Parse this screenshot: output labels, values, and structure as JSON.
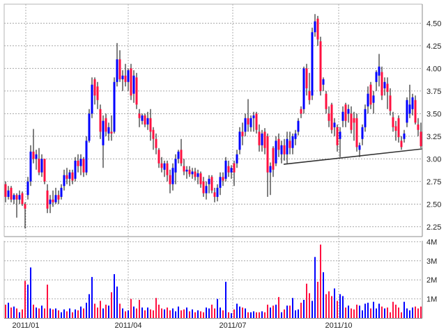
{
  "chart_data": {
    "type": "candlestick",
    "title": "",
    "colors": {
      "up": "#0000ff",
      "down": "#ff1040",
      "flat": "#000000",
      "wick": "#000000",
      "grid": "#999999",
      "trendline": "#333333"
    },
    "price_axis": {
      "ylim": [
        2.15,
        4.72
      ],
      "ticks": [
        "2.25",
        "2.50",
        "2.75",
        "3.00",
        "3.25",
        "3.50",
        "3.75",
        "4.00",
        "4.25",
        "4.50"
      ],
      "position": "right"
    },
    "volume_axis": {
      "ylim": [
        0,
        4.0
      ],
      "unit": "M",
      "ticks": [
        {
          "value": 1,
          "label": "1M"
        },
        {
          "value": 2,
          "label": "2M"
        },
        {
          "value": 3,
          "label": "3M"
        },
        {
          "value": 4,
          "label": "4M"
        }
      ],
      "position": "right"
    },
    "x_ticks": [
      {
        "label": "2011/01",
        "index": 7.25
      },
      {
        "label": "2011/04",
        "index": 44
      },
      {
        "label": "2011/07",
        "index": 81.5
      },
      {
        "label": "2011/10",
        "index": 119.5
      }
    ],
    "trendline": {
      "from": {
        "index": 99.75,
        "price": 2.94
      },
      "to": {
        "index": 149.5,
        "price": 3.11
      }
    },
    "ohlc": [
      [
        2.72,
        2.75,
        2.52,
        2.58
      ],
      [
        2.58,
        2.7,
        2.55,
        2.65
      ],
      [
        2.68,
        2.7,
        2.52,
        2.55
      ],
      [
        2.55,
        2.62,
        2.5,
        2.6
      ],
      [
        2.6,
        2.62,
        2.35,
        2.55
      ],
      [
        2.55,
        2.65,
        2.5,
        2.6
      ],
      [
        2.62,
        2.64,
        2.48,
        2.5
      ],
      [
        2.5,
        2.52,
        2.23,
        2.45
      ],
      [
        2.6,
        2.8,
        2.55,
        2.75
      ],
      [
        2.75,
        3.15,
        2.7,
        3.08
      ],
      [
        3.08,
        3.33,
        2.95,
        3.0
      ],
      [
        3.0,
        3.1,
        2.88,
        3.05
      ],
      [
        3.0,
        3.12,
        2.82,
        2.85
      ],
      [
        2.85,
        3.05,
        2.8,
        3.0
      ],
      [
        3.0,
        3.0,
        2.72,
        2.75
      ],
      [
        2.65,
        2.72,
        2.4,
        2.45
      ],
      [
        2.5,
        2.6,
        2.4,
        2.55
      ],
      [
        2.55,
        2.65,
        2.47,
        2.52
      ],
      [
        2.52,
        2.68,
        2.5,
        2.6
      ],
      [
        2.6,
        2.65,
        2.5,
        2.55
      ],
      [
        2.58,
        2.72,
        2.55,
        2.68
      ],
      [
        2.7,
        2.88,
        2.65,
        2.82
      ],
      [
        2.82,
        2.9,
        2.72,
        2.78
      ],
      [
        2.78,
        2.88,
        2.7,
        2.85
      ],
      [
        2.85,
        2.88,
        2.72,
        2.76
      ],
      [
        2.78,
        3.02,
        2.75,
        2.98
      ],
      [
        2.98,
        3.05,
        2.85,
        2.92
      ],
      [
        2.92,
        3.05,
        2.82,
        3.0
      ],
      [
        3.0,
        3.02,
        2.8,
        2.85
      ],
      [
        2.85,
        3.25,
        2.82,
        3.2
      ],
      [
        3.2,
        3.55,
        3.18,
        3.5
      ],
      [
        3.5,
        3.9,
        3.45,
        3.82
      ],
      [
        3.88,
        3.9,
        3.6,
        3.7
      ],
      [
        3.8,
        3.85,
        3.55,
        3.65
      ],
      [
        3.55,
        3.6,
        3.22,
        3.3
      ],
      [
        3.15,
        3.48,
        2.9,
        3.42
      ],
      [
        3.45,
        3.5,
        3.25,
        3.3
      ],
      [
        3.28,
        3.4,
        3.2,
        3.35
      ],
      [
        3.3,
        3.48,
        3.2,
        3.28
      ],
      [
        3.3,
        3.9,
        3.28,
        3.85
      ],
      [
        3.85,
        4.28,
        3.8,
        4.1
      ],
      [
        4.1,
        4.2,
        3.85,
        3.88
      ],
      [
        3.88,
        3.98,
        3.75,
        3.92
      ],
      [
        3.92,
        4.05,
        3.8,
        3.85
      ],
      [
        3.85,
        4.0,
        3.75,
        3.98
      ],
      [
        4.0,
        4.05,
        3.65,
        3.7
      ],
      [
        3.72,
        3.98,
        3.62,
        3.92
      ],
      [
        3.9,
        3.95,
        3.55,
        3.6
      ],
      [
        3.5,
        3.55,
        3.35,
        3.45
      ],
      [
        3.42,
        3.5,
        3.38,
        3.48
      ],
      [
        3.48,
        3.5,
        3.35,
        3.38
      ],
      [
        3.38,
        3.52,
        3.32,
        3.45
      ],
      [
        3.45,
        3.55,
        3.2,
        3.3
      ],
      [
        3.32,
        3.35,
        3.1,
        3.22
      ],
      [
        3.22,
        3.28,
        3.05,
        3.12
      ],
      [
        3.1,
        3.12,
        2.9,
        2.95
      ],
      [
        2.95,
        3.02,
        2.85,
        2.9
      ],
      [
        2.88,
        2.98,
        2.8,
        2.95
      ],
      [
        2.95,
        2.98,
        2.75,
        2.82
      ],
      [
        2.82,
        2.88,
        2.62,
        2.72
      ],
      [
        2.72,
        2.95,
        2.65,
        2.9
      ],
      [
        2.85,
        3.05,
        2.72,
        3.0
      ],
      [
        3.0,
        3.1,
        2.95,
        3.08
      ],
      [
        3.1,
        3.22,
        2.92,
        2.95
      ],
      [
        2.92,
        3.0,
        2.82,
        2.86
      ],
      [
        2.86,
        2.92,
        2.78,
        2.88
      ],
      [
        2.88,
        2.92,
        2.8,
        2.83
      ],
      [
        2.83,
        2.9,
        2.78,
        2.86
      ],
      [
        2.86,
        2.9,
        2.76,
        2.8
      ],
      [
        2.8,
        2.88,
        2.72,
        2.84
      ],
      [
        2.84,
        2.86,
        2.68,
        2.72
      ],
      [
        2.75,
        2.8,
        2.58,
        2.62
      ],
      [
        2.62,
        2.75,
        2.55,
        2.7
      ],
      [
        2.72,
        2.82,
        2.62,
        2.78
      ],
      [
        2.8,
        2.82,
        2.62,
        2.65
      ],
      [
        2.63,
        2.68,
        2.52,
        2.58
      ],
      [
        2.58,
        2.72,
        2.53,
        2.68
      ],
      [
        2.68,
        2.85,
        2.6,
        2.8
      ],
      [
        2.8,
        2.85,
        2.7,
        2.76
      ],
      [
        2.78,
        3.02,
        2.75,
        2.98
      ],
      [
        2.92,
        2.98,
        2.8,
        2.85
      ],
      [
        2.85,
        2.93,
        2.78,
        2.9
      ],
      [
        2.95,
        2.98,
        2.7,
        2.85
      ],
      [
        2.95,
        3.1,
        2.9,
        3.05
      ],
      [
        3.1,
        3.35,
        3.05,
        3.3
      ],
      [
        3.3,
        3.4,
        3.15,
        3.25
      ],
      [
        3.3,
        3.5,
        3.25,
        3.45
      ],
      [
        3.45,
        3.66,
        3.3,
        3.38
      ],
      [
        3.35,
        3.48,
        3.3,
        3.45
      ],
      [
        3.45,
        3.52,
        3.3,
        3.48
      ],
      [
        3.5,
        3.52,
        3.28,
        3.32
      ],
      [
        3.3,
        3.38,
        3.08,
        3.15
      ],
      [
        3.15,
        3.32,
        3.08,
        3.28
      ],
      [
        3.3,
        3.34,
        3.05,
        3.12
      ],
      [
        3.25,
        3.28,
        2.58,
        2.85
      ],
      [
        2.85,
        2.96,
        2.6,
        2.92
      ],
      [
        3.12,
        3.14,
        2.8,
        2.88
      ],
      [
        2.95,
        3.25,
        2.92,
        3.2
      ],
      [
        3.22,
        3.28,
        3.02,
        3.1
      ],
      [
        3.05,
        3.2,
        2.95,
        3.15
      ],
      [
        3.15,
        3.22,
        2.98,
        3.05
      ],
      [
        3.05,
        3.3,
        2.95,
        3.22
      ],
      [
        3.2,
        3.3,
        3.05,
        3.12
      ],
      [
        3.12,
        3.28,
        3.05,
        3.25
      ],
      [
        3.22,
        3.32,
        3.15,
        3.28
      ],
      [
        3.3,
        3.45,
        3.26,
        3.42
      ],
      [
        3.55,
        3.58,
        3.45,
        3.5
      ],
      [
        3.55,
        4.02,
        3.5,
        4.0
      ],
      [
        4.0,
        4.05,
        3.7,
        3.78
      ],
      [
        3.75,
        3.95,
        3.6,
        3.65
      ],
      [
        3.7,
        4.45,
        3.65,
        4.4
      ],
      [
        4.4,
        4.6,
        4.35,
        4.52
      ],
      [
        4.55,
        4.58,
        4.25,
        4.32
      ],
      [
        4.3,
        4.35,
        3.7,
        3.75
      ],
      [
        3.82,
        3.9,
        3.75,
        3.88
      ],
      [
        3.72,
        3.75,
        3.5,
        3.55
      ],
      [
        3.5,
        3.58,
        3.35,
        3.42
      ],
      [
        3.6,
        3.62,
        3.28,
        3.32
      ],
      [
        3.35,
        3.45,
        3.25,
        3.4
      ],
      [
        3.35,
        3.38,
        3.08,
        3.15
      ],
      [
        3.22,
        3.35,
        3.02,
        3.3
      ],
      [
        3.42,
        3.58,
        3.35,
        3.52
      ],
      [
        3.6,
        3.62,
        3.35,
        3.42
      ],
      [
        3.5,
        3.6,
        3.4,
        3.55
      ],
      [
        3.5,
        3.58,
        3.28,
        3.32
      ],
      [
        3.45,
        3.52,
        3.2,
        3.4
      ],
      [
        3.45,
        3.5,
        3.08,
        3.13
      ],
      [
        3.1,
        3.18,
        3.02,
        3.15
      ],
      [
        3.22,
        3.38,
        3.15,
        3.35
      ],
      [
        3.35,
        3.6,
        3.3,
        3.55
      ],
      [
        3.58,
        3.8,
        3.5,
        3.72
      ],
      [
        3.82,
        3.85,
        3.55,
        3.6
      ],
      [
        3.62,
        3.75,
        3.5,
        3.7
      ],
      [
        3.85,
        3.98,
        3.75,
        3.96
      ],
      [
        3.92,
        4.16,
        3.8,
        4.02
      ],
      [
        3.96,
        4.02,
        3.65,
        3.7
      ],
      [
        3.78,
        3.9,
        3.7,
        3.85
      ],
      [
        3.83,
        3.9,
        3.55,
        3.74
      ],
      [
        3.7,
        3.78,
        3.48,
        3.53
      ],
      [
        3.46,
        3.52,
        3.3,
        3.35
      ],
      [
        3.36,
        3.42,
        3.2,
        3.31
      ],
      [
        3.45,
        3.48,
        3.18,
        3.24
      ],
      [
        3.2,
        3.25,
        3.1,
        3.13
      ],
      [
        3.22,
        3.32,
        3.18,
        3.28
      ],
      [
        3.4,
        3.68,
        3.35,
        3.65
      ],
      [
        3.5,
        3.82,
        3.45,
        3.6
      ],
      [
        3.55,
        3.72,
        3.48,
        3.68
      ],
      [
        3.65,
        3.7,
        3.38,
        3.4
      ],
      [
        3.38,
        3.45,
        3.25,
        3.32
      ],
      [
        3.3,
        3.4,
        3.12,
        3.14
      ]
    ],
    "volume_millions": [
      0.7,
      0.8,
      0.55,
      0.6,
      0.5,
      0.3,
      0.45,
      1.95,
      1.75,
      2.65,
      0.7,
      0.55,
      0.5,
      0.65,
      0.5,
      1.75,
      0.5,
      0.45,
      0.5,
      0.4,
      0.3,
      0.45,
      0.35,
      0.5,
      0.3,
      0.45,
      0.4,
      0.6,
      0.5,
      0.8,
      1.25,
      2.15,
      0.75,
      0.55,
      0.9,
      0.5,
      0.7,
      0.65,
      1.35,
      2.3,
      1.65,
      0.75,
      0.5,
      0.35,
      0.4,
      1.0,
      0.6,
      0.5,
      0.95,
      0.55,
      0.4,
      0.55,
      0.45,
      0.4,
      1.05,
      0.7,
      0.5,
      0.45,
      0.55,
      0.4,
      0.5,
      0.35,
      0.6,
      0.4,
      0.45,
      0.55,
      0.35,
      0.45,
      0.3,
      0.4,
      0.35,
      0.3,
      0.55,
      0.5,
      0.7,
      0.5,
      1.0,
      0.55,
      0.4,
      1.9,
      0.3,
      0.25,
      0.45,
      0.75,
      0.6,
      0.55,
      0.5,
      0.3,
      0.3,
      0.35,
      0.3,
      0.3,
      0.35,
      0.3,
      0.7,
      0.55,
      0.65,
      0.7,
      1.1,
      0.3,
      0.45,
      0.65,
      0.65,
      1.05,
      0.4,
      0.45,
      0.8,
      0.95,
      1.8,
      1.3,
      0.9,
      3.2,
      1.9,
      3.85,
      2.4,
      1.25,
      1.4,
      1.15,
      1.55,
      0.9,
      1.25,
      1.15,
      0.55,
      0.65,
      0.5,
      0.45,
      0.7,
      0.65,
      0.4,
      0.75,
      0.8,
      0.5,
      0.85,
      0.5,
      0.75,
      0.6,
      0.5,
      0.55,
      0.3,
      0.85,
      0.7,
      0.55,
      0.3,
      0.85,
      0.5,
      0.4,
      0.55,
      0.6,
      0.5,
      0.6
    ]
  }
}
